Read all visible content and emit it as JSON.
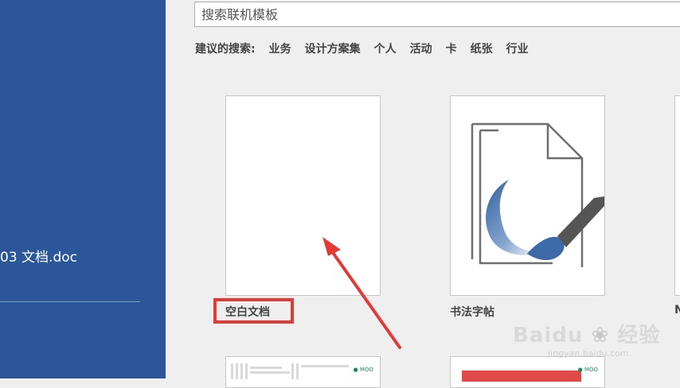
{
  "sidebar": {
    "recent_doc": "03 文档.doc"
  },
  "search": {
    "placeholder": "搜索联机模板"
  },
  "suggested": {
    "label": "建议的搜索:",
    "items": [
      "业务",
      "设计方案集",
      "个人",
      "活动",
      "卡",
      "纸张",
      "行业"
    ]
  },
  "templates": [
    {
      "label": "空白文档"
    },
    {
      "label": "书法字帖"
    },
    {
      "label": "N"
    }
  ],
  "bottom_tiles": [
    {
      "brand": "MOO"
    },
    {
      "brand": "MOO"
    }
  ],
  "watermark": {
    "logo": "Baidu",
    "text": "经验",
    "url": "jingyan.baidu.com"
  },
  "colors": {
    "sidebar": "#2b579a",
    "highlight": "#e43a36",
    "accent_green": "#1a8c5b"
  }
}
